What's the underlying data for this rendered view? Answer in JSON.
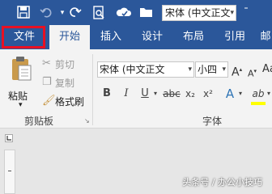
{
  "qat": {
    "font_name": "宋体 (中文正文",
    "icons": [
      "save-icon",
      "undo-icon",
      "redo-icon",
      "print-preview-icon",
      "save-cloud-icon",
      "open-folder-icon"
    ]
  },
  "tabs": [
    "文件",
    "开始",
    "插入",
    "设计",
    "布局",
    "引用",
    "邮"
  ],
  "active_tab": "开始",
  "clipboard": {
    "paste": "粘贴",
    "cut": "剪切",
    "copy": "复制",
    "format_painter": "格式刷",
    "group": "剪贴板"
  },
  "font": {
    "name": "宋体 (中文正文",
    "size": "小四",
    "group": "字体",
    "size_up": "A",
    "size_down": "A",
    "case": "Aa",
    "bold": "B",
    "italic": "I",
    "underline": "U",
    "strike": "abc",
    "subscript": "x₂",
    "superscript": "x²",
    "effects": "A",
    "highlight": "ab"
  },
  "watermark": "头条号 / 办公小技巧",
  "colors": {
    "accent": "#2b579a",
    "highlight_file": "#e81123",
    "ribbon": "#f3f3f3"
  }
}
